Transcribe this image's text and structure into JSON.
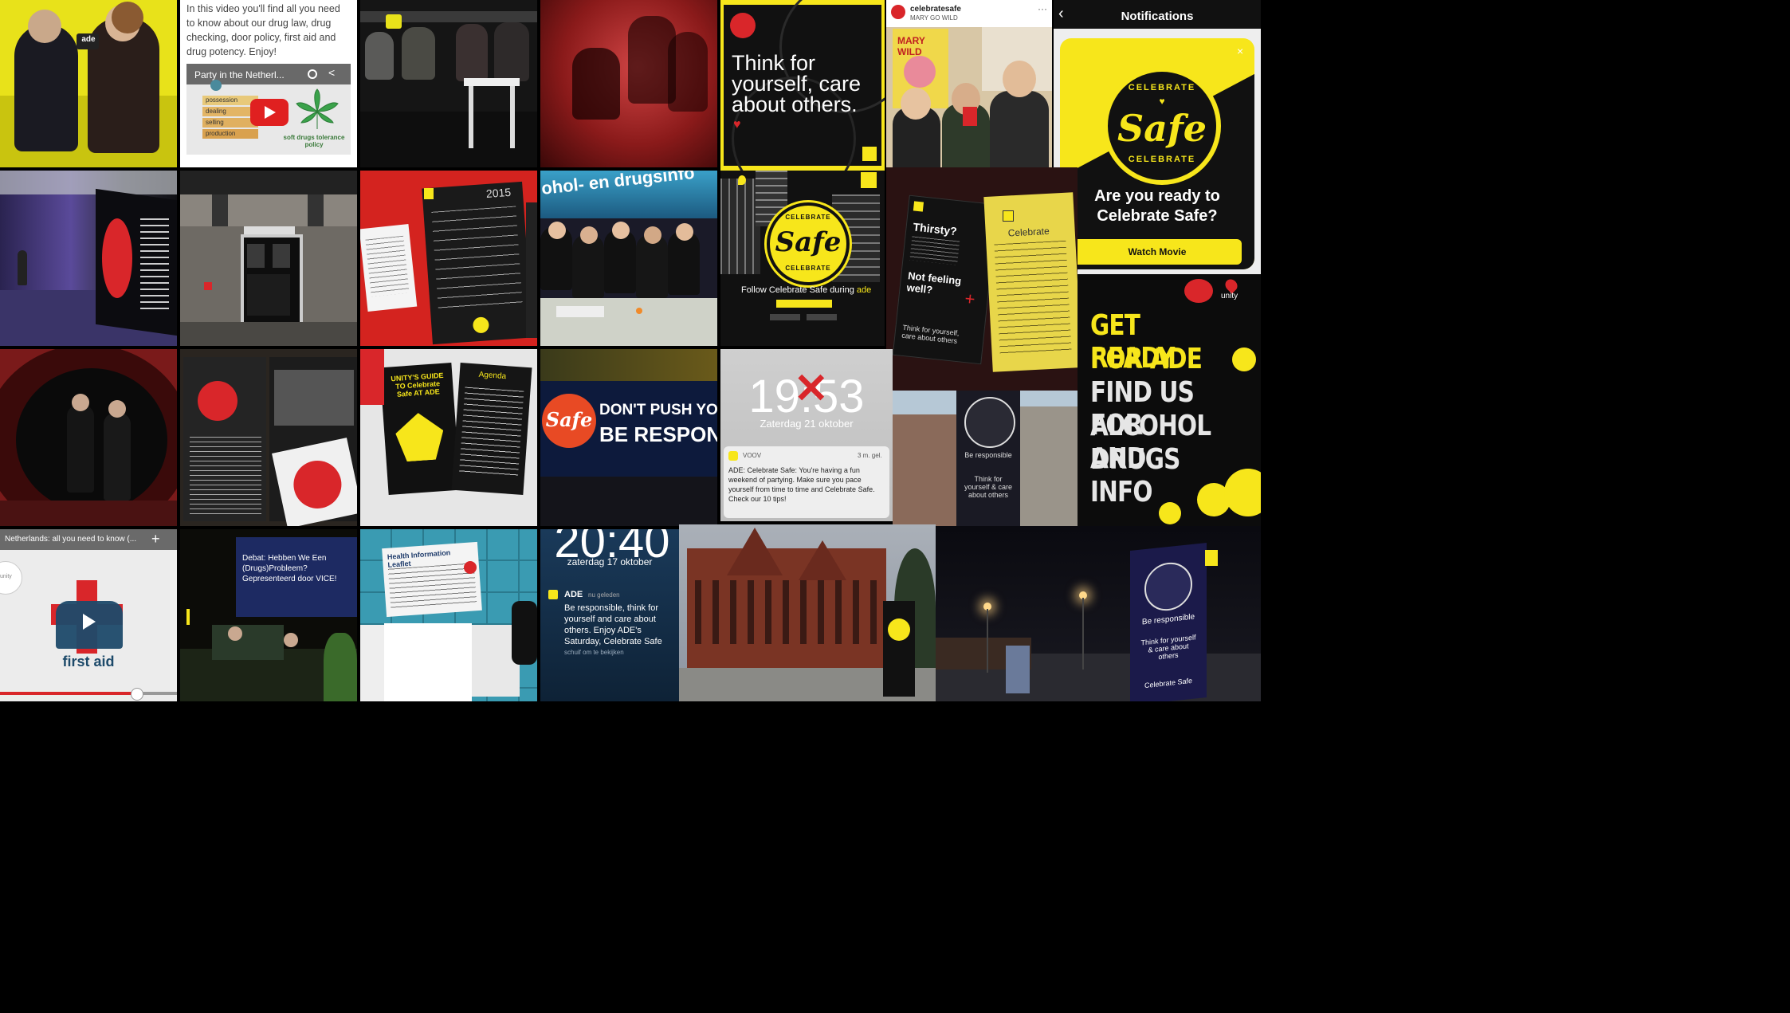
{
  "tiles": {
    "ade_logo": "ade",
    "video_intro": "In this video you'll find all you need to know about our drug law, drug checking, door policy, first aid and drug potency. Enjoy!",
    "video_title": "Party in the Netherl...",
    "video_diagram_labels": [
      "possession",
      "dealing",
      "selling",
      "production"
    ],
    "soft_drugs_label": "soft drugs tolerance policy",
    "celebrate_word": "CELEBRATE",
    "safe_word": "Safe",
    "think_slogan": "Think for yourself, care about others.",
    "instagram_user": "celebratesafe",
    "instagram_location": "MARY GO WILD",
    "poster_word": "MARY WILD",
    "notif_header": "Notifications",
    "ready_text": "Are you ready to Celebrate Safe?",
    "watch_button": "Watch Movie",
    "year_label": "2015",
    "tent_sign": "ohol- en drugsinfo",
    "follow_text": "Follow Celebrate Safe during",
    "follow_ade": "ade",
    "thirsty_text": "Thirsty?",
    "notwell_text": "Not feeling well?",
    "think_small": "Think for yourself, care about others",
    "celebrate_small": "Celebrate",
    "unity_label": "unity",
    "get_ready_lines": [
      "GET READY",
      "FOR ADE",
      "FIND US FOR",
      "ALCOHOL AND",
      "DRUGS INFO"
    ],
    "lock_time": "19:53",
    "lock_date": "Zaterdag 21 oktober",
    "notif_app": "VOOV",
    "notif_time": "3 m. gel.",
    "notif_body": "ADE: Celebrate Safe: You're having a fun weekend of partying. Make sure you pace yourself from time to time and Celebrate Safe. Check our 10 tips!",
    "banner_line1": "DON'T PUSH YOU",
    "banner_line2": "BE RESPON",
    "leaflet_title": "UNITY'S GUIDE TO Celebrate Safe AT ADE",
    "agenda_title": "Agenda",
    "pillar_text1": "Be responsible",
    "pillar_text2": "Think for yourself & care about others",
    "first_aid_topbar": "Netherlands: all you need to know (...",
    "first_aid_label": "first aid",
    "unity_bubble": "unity",
    "stage_screen": "Debat: Hebben We Een (Drugs)Probleem? Gepresenteerd door VICE!",
    "health_leaflet": "Health Information Leaflet",
    "lock2_time": "20:40",
    "lock2_date": "zaterdag 17 oktober",
    "lock2_app": "ADE",
    "lock2_meta": "nu geleden",
    "lock2_body": "Be responsible, think for yourself and care about others. Enjoy ADE's Saturday, Celebrate Safe",
    "lock2_action": "schuif om te bekijken",
    "tower_text1": "Be responsible",
    "tower_text2": "Think for yourself & care about others",
    "tower_text3": "Celebrate Safe"
  },
  "colors": {
    "brand_yellow": "#f7e61b",
    "brand_red": "#d9262a",
    "black": "#000000",
    "white": "#ffffff"
  }
}
